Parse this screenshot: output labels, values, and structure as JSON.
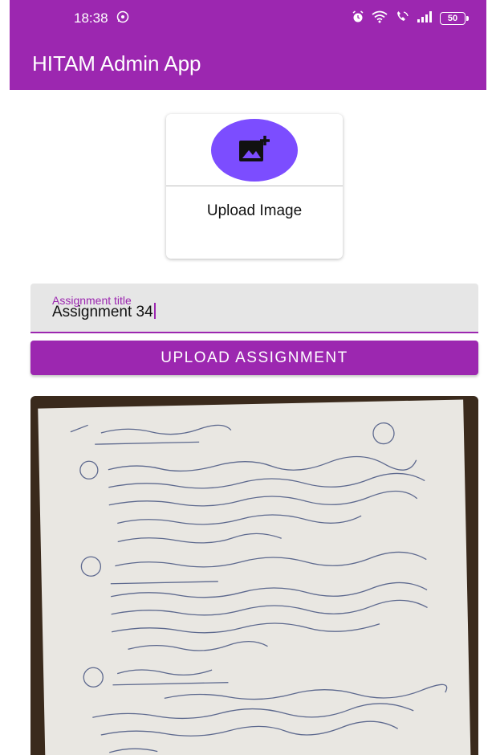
{
  "status_bar": {
    "time": "18:38",
    "battery": "50",
    "icons": [
      "whatsapp-icon",
      "alarm-icon",
      "wifi-icon",
      "vowifi-icon",
      "signal-icon",
      "battery-icon"
    ]
  },
  "app_bar": {
    "title": "HITAM Admin App"
  },
  "upload_card": {
    "icon": "add-photo-icon",
    "label": "Upload Image"
  },
  "assignment_field": {
    "label": "Assignment title",
    "value": "Assignment 34"
  },
  "upload_button": {
    "label": "UPLOAD ASSIGNMENT"
  },
  "colors": {
    "primary": "#9c27b0",
    "accent": "#7c4dff",
    "field_bg": "#e6e6e6"
  }
}
